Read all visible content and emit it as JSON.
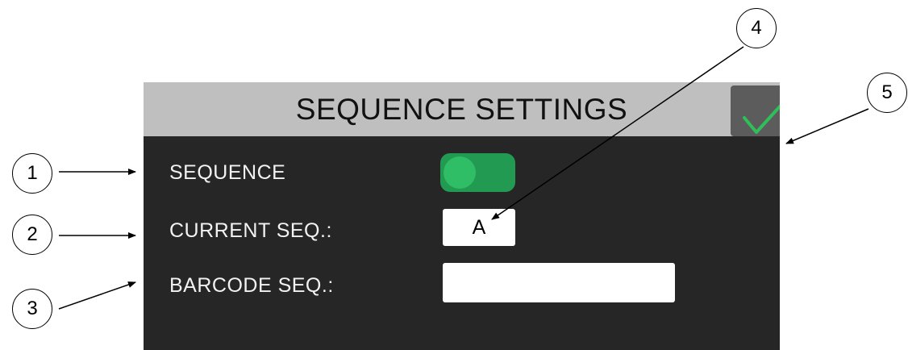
{
  "panel": {
    "title": "SEQUENCE SETTINGS",
    "confirm_icon": "checkmark-icon",
    "rows": [
      {
        "label": "SEQUENCE",
        "control": "toggle",
        "state": "on"
      },
      {
        "label": "CURRENT SEQ.:",
        "control": "value-field",
        "value": "A"
      },
      {
        "label": "BARCODE SEQ.:",
        "control": "text-input",
        "value": ""
      }
    ]
  },
  "callouts": [
    "1",
    "2",
    "3",
    "4",
    "5"
  ],
  "colors": {
    "header": "#bfbfbf",
    "panel_bg": "#262626",
    "toggle_on": "#239a52",
    "check": "#2fbf5a"
  }
}
